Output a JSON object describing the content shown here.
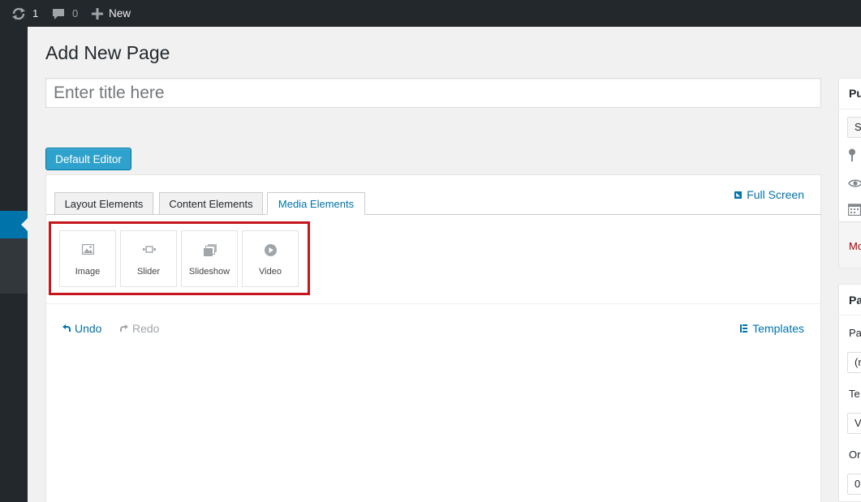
{
  "adminbar": {
    "updates_count": "1",
    "comments_count": "0",
    "new_label": "New"
  },
  "page": {
    "title": "Add New Page",
    "title_placeholder": "Enter title here",
    "default_editor_label": "Default Editor"
  },
  "builder": {
    "tabs": [
      {
        "label": "Layout Elements",
        "active": false
      },
      {
        "label": "Content Elements",
        "active": false
      },
      {
        "label": "Media Elements",
        "active": true
      }
    ],
    "fullscreen_label": "Full Screen",
    "elements": [
      {
        "label": "Image",
        "icon": "image-icon"
      },
      {
        "label": "Slider",
        "icon": "slider-icon"
      },
      {
        "label": "Slideshow",
        "icon": "slideshow-icon"
      },
      {
        "label": "Video",
        "icon": "video-icon"
      }
    ],
    "undo_label": "Undo",
    "redo_label": "Redo",
    "templates_label": "Templates"
  },
  "sidebar": {
    "publish_heading": "Pu",
    "save_draft_label": "S",
    "move_to_trash": "Mo",
    "attributes_heading": "Pa",
    "parent_label": "Pa",
    "parent_value": "(n",
    "template_label": "Te",
    "template_value": "V",
    "order_label": "Or",
    "order_value": "0"
  },
  "colors": {
    "admin_bar": "#23282d",
    "accent": "#0073aa",
    "button": "#2ea2cc",
    "highlight": "#c4161c"
  }
}
